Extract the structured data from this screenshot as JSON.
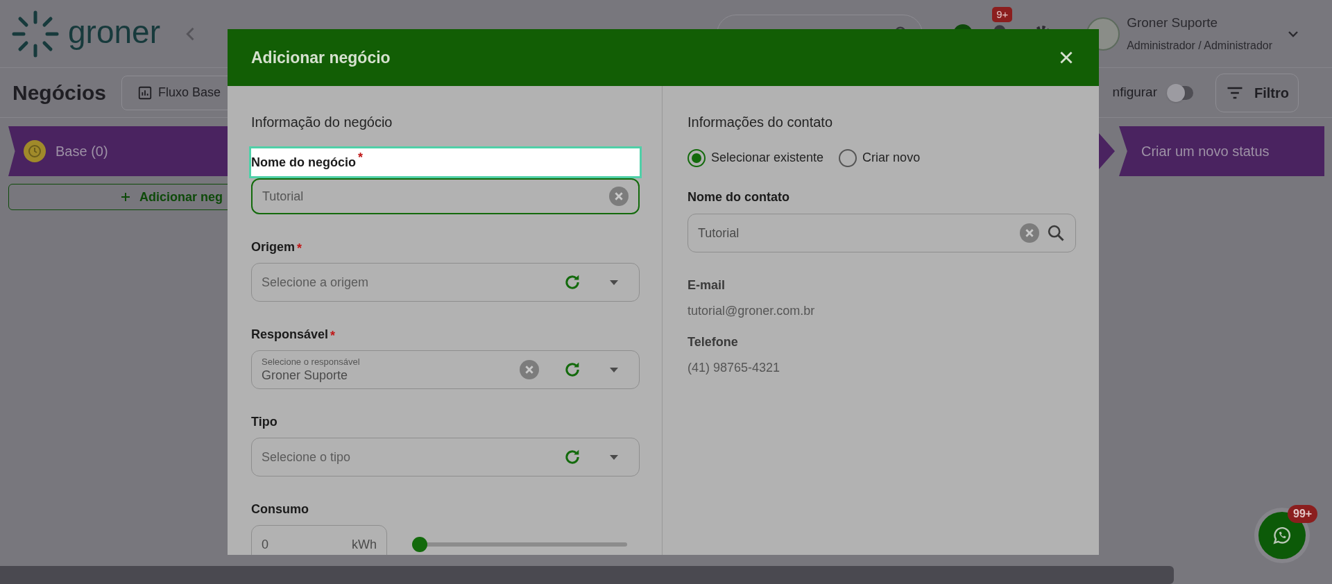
{
  "header": {
    "logo": "groner",
    "notification_badge": "9+",
    "user": {
      "name": "Groner Suporte",
      "role": "Administrador / Administrador"
    }
  },
  "toolbar": {
    "title": "Negócios",
    "flow_button": "Fluxo Base",
    "configure_label": "nfigurar",
    "configure_toggle_on": false,
    "filter_button": "Filtro"
  },
  "board": {
    "column_label": "Base (0)",
    "add_button": "Adicionar neg",
    "new_status": "Criar um novo status"
  },
  "modal": {
    "title": "Adicionar negócio",
    "left": {
      "heading": "Informação do negócio",
      "fields": [
        {
          "kind": "text",
          "label": "Nome do negócio",
          "required_mark": "*",
          "value": "Tutorial",
          "highlighted": true
        },
        {
          "kind": "select",
          "label": "Origem",
          "required_mark": "*",
          "placeholder": "Selecione a origem"
        },
        {
          "kind": "select",
          "label": "Responsável",
          "required_mark": "*",
          "placeholder": "Selecione o responsável",
          "value": "Groner Suporte"
        },
        {
          "kind": "select",
          "label": "Tipo",
          "placeholder": "Selecione o tipo"
        },
        {
          "kind": "range",
          "label": "Consumo",
          "value": "0",
          "unit": "kWh",
          "level": 0
        }
      ]
    },
    "right": {
      "heading": "Informações do contato",
      "radios": [
        {
          "label": "Selecionar existente",
          "selected": true
        },
        {
          "label": "Criar novo",
          "selected": false
        }
      ],
      "contact_field": {
        "label": "Nome do contato",
        "value": "Tutorial"
      },
      "details": [
        {
          "label": "E-mail",
          "value": "tutorial@groner.com.br"
        },
        {
          "label": "Telefone",
          "value": "(41) 98765-4321"
        }
      ]
    }
  },
  "whatsapp": {
    "badge": "99+"
  }
}
